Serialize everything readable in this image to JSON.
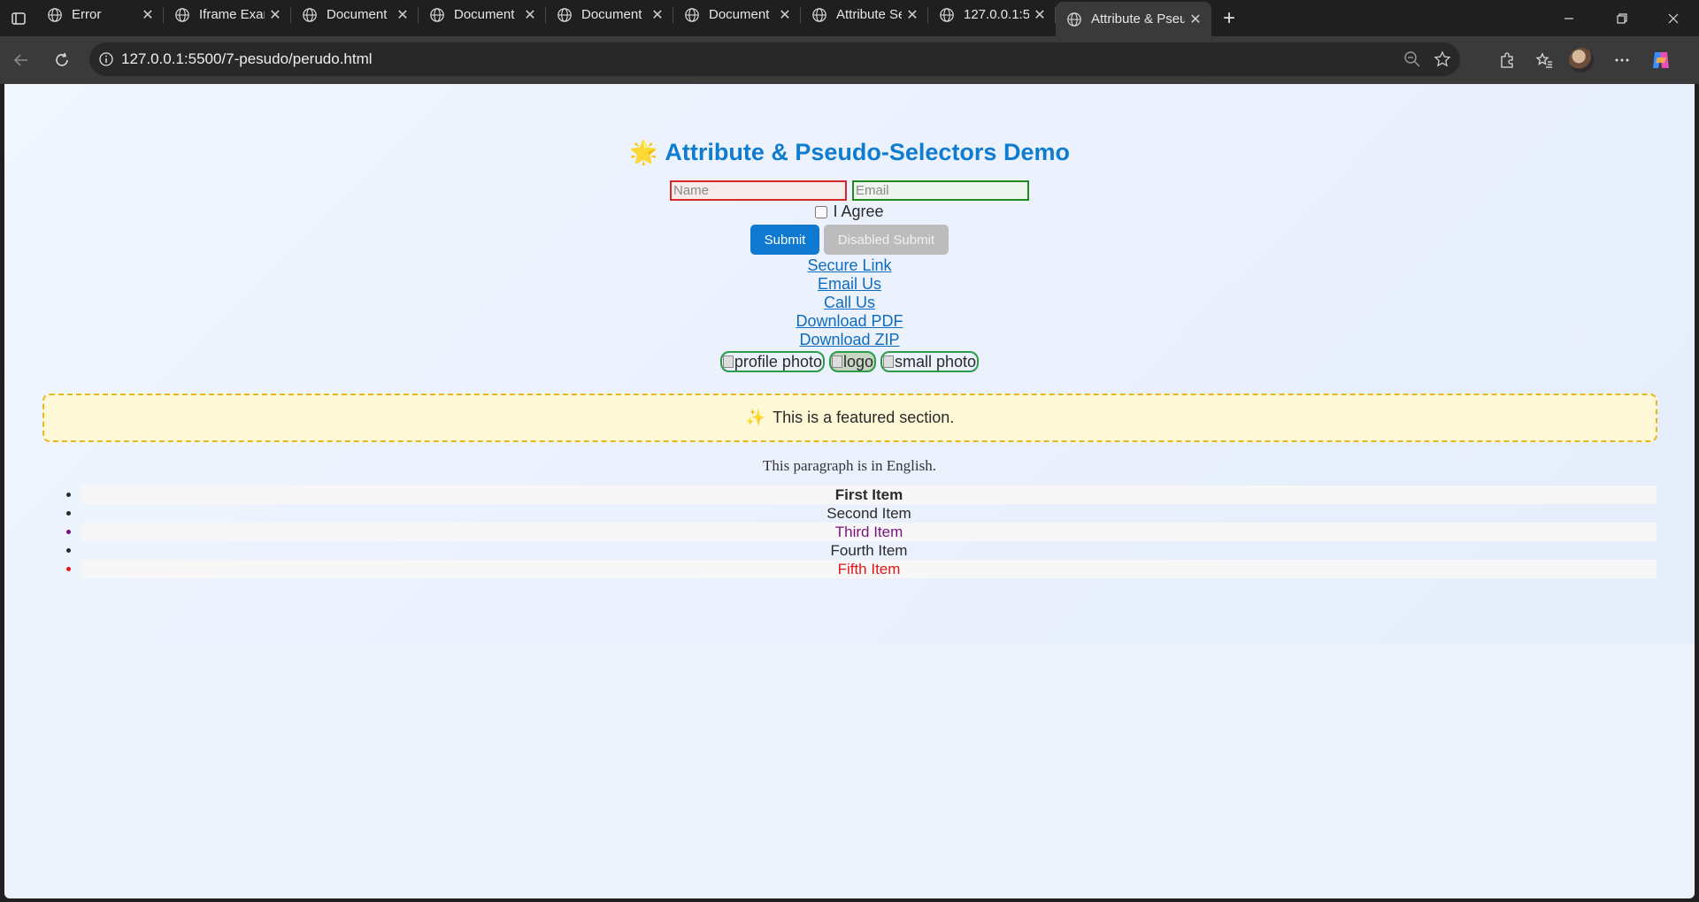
{
  "browser": {
    "tabs": [
      {
        "title": "Error",
        "active": false
      },
      {
        "title": "Iframe Example",
        "active": false
      },
      {
        "title": "Document",
        "active": false
      },
      {
        "title": "Document",
        "active": false
      },
      {
        "title": "Document",
        "active": false
      },
      {
        "title": "Document",
        "active": false
      },
      {
        "title": "Attribute Selectors",
        "active": false
      },
      {
        "title": "127.0.0.1:5500/",
        "active": false
      },
      {
        "title": "Attribute & Pseudo",
        "active": true
      }
    ],
    "address": "127.0.0.1:5500/7-pesudo/perudo.html",
    "new_tab_label": "+"
  },
  "page": {
    "title_icon": "🌟",
    "title": "Attribute & Pseudo-Selectors Demo",
    "form": {
      "name_placeholder": "Name",
      "email_placeholder": "Email",
      "agree_label": "I Agree",
      "submit_label": "Submit",
      "disabled_submit_label": "Disabled Submit"
    },
    "links": [
      "Secure Link",
      "Email Us",
      "Call Us",
      "Download PDF",
      "Download ZIP"
    ],
    "images": [
      "profile photo",
      "logo",
      "small photo"
    ],
    "featured_icon": "✨",
    "featured_text": "This is a featured section.",
    "paragraph": "This paragraph is in English.",
    "list": [
      "First Item",
      "Second Item",
      "Third Item",
      "Fourth Item",
      "Fifth Item"
    ]
  },
  "colors": {
    "title": "#0f7ccf",
    "link": "#0f6cbd",
    "submit": "#0f78d0",
    "featured_border": "#e6b81f",
    "third_item": "#7b127b",
    "fifth_item": "#e11818"
  }
}
